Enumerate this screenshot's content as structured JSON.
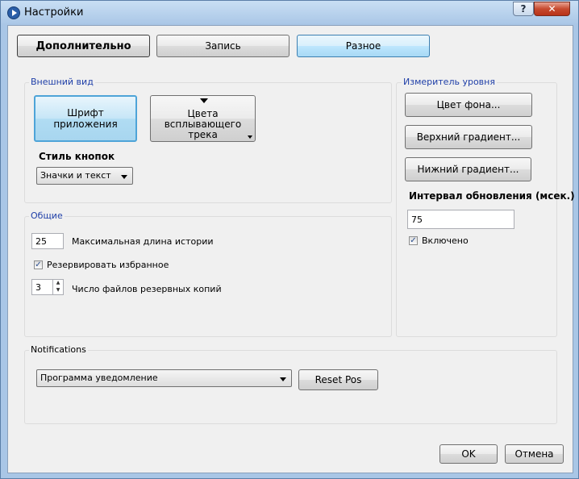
{
  "window": {
    "title": "Настройки",
    "help": "?",
    "close": "✕"
  },
  "tabs": {
    "advanced": "Дополнительно",
    "record": "Запись",
    "misc": "Разное"
  },
  "appearance": {
    "title": "Внешний вид",
    "font_button": "Шрифт\nприложения",
    "colors_button": "Цвета\nвсплывающего\nтрека",
    "button_style_label": "Стиль кнопок",
    "button_style_value": "Значки и текст"
  },
  "general": {
    "title": "Общие",
    "history_value": "25",
    "history_label": "Максимальная длина истории",
    "backup_favorites_label": "Резервировать избранное",
    "backup_favorites_checked": true,
    "backup_count_value": "3",
    "backup_count_label": "Число файлов резервных копий"
  },
  "level_meter": {
    "title": "Измеритель уровня",
    "bg_color_button": "Цвет фона...",
    "top_gradient_button": "Верхний градиент...",
    "bottom_gradient_button": "Нижний градиент...",
    "interval_label": "Интервал обновления (мсек.)",
    "interval_value": "75",
    "enabled_label": "Включено",
    "enabled_checked": true
  },
  "notifications": {
    "title": "Notifications",
    "program_value": "Программа уведомление",
    "reset_pos": "Reset Pos"
  },
  "footer": {
    "ok": "OK",
    "cancel": "Отмена"
  },
  "icons": {
    "app": "media-player-icon",
    "check": "✓"
  }
}
